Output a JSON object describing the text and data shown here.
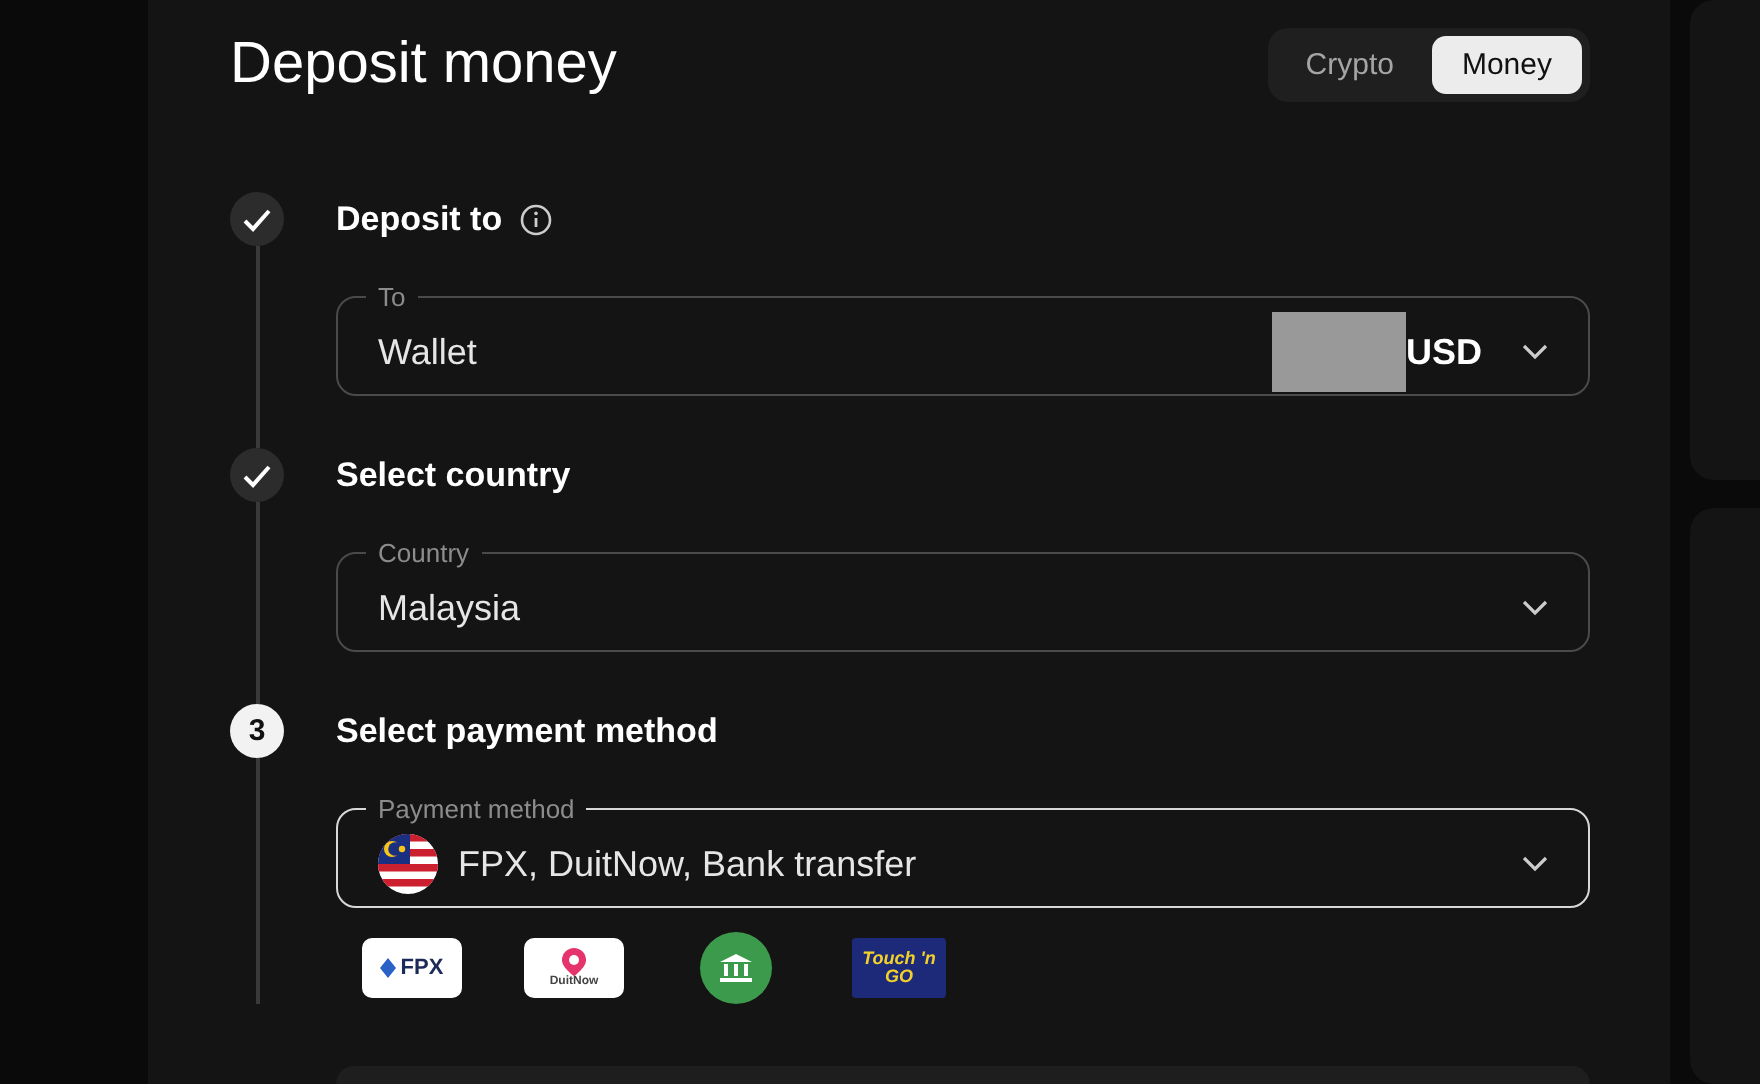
{
  "title": "Deposit money",
  "mode_toggle": [
    {
      "label": "Crypto",
      "selected": false
    },
    {
      "label": "Money",
      "selected": true
    }
  ],
  "steps": [
    {
      "completed": true,
      "heading": "Deposit to",
      "info": true,
      "field": {
        "label": "To",
        "value": "Wallet",
        "redacted": true,
        "suffix": "USD"
      }
    },
    {
      "completed": true,
      "heading": "Select country",
      "field": {
        "label": "Country",
        "value": "Malaysia"
      }
    },
    {
      "completed": false,
      "number": "3",
      "heading": "Select payment method",
      "field": {
        "label": "Payment method",
        "value": "FPX, DuitNow, Bank transfer",
        "flag": true
      },
      "logos": [
        {
          "kind": "fpx",
          "text": "FPX"
        },
        {
          "kind": "duitnow",
          "text": "DuitNow"
        },
        {
          "kind": "bank"
        },
        {
          "kind": "touchngo",
          "text": "Touch 'n GO"
        }
      ]
    }
  ]
}
